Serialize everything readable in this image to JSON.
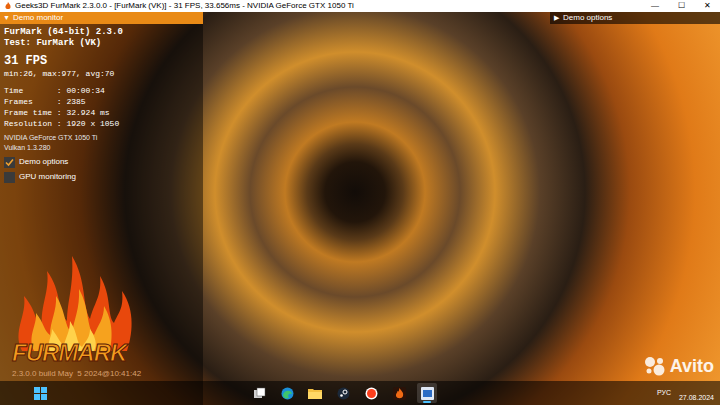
{
  "window": {
    "title": "Geeks3D FurMark 2.3.0.0 - [FurMark (VK)] - 31 FPS, 33.656ms - NVIDIA GeForce GTX 1050 Ti",
    "controls": [
      "—",
      "☐",
      "✕"
    ]
  },
  "demo_monitor": {
    "arrow": "▼",
    "header": "Demo monitor",
    "expanded": true,
    "app": "FurMark (64-bit) 2.3.0",
    "test": "Test: FurMark (VK)",
    "fps": "31 FPS",
    "stats": "min:26, max:977, avg:70",
    "info": [
      "Time       : 00:00:34",
      "Frames     : 2385",
      "Frame time : 32.924 ms",
      "Resolution : 1920 x 1050"
    ],
    "gpu": "NVIDIA GeForce GTX 1050 Ti",
    "api": "Vulkan 1.3.280",
    "options": [
      {
        "label": "Demo options",
        "checked": true
      },
      {
        "label": "GPU monitoring",
        "checked": false
      }
    ]
  },
  "demo_options": {
    "arrow": "▶",
    "header": "Demo options",
    "expanded": false
  },
  "logo": {
    "text": "FURMARK",
    "build": "2.3.0.0 build May  5 2024@10:41:42"
  },
  "taskbar": {
    "start": {
      "kind": "start"
    },
    "apps": [
      {
        "kind": "taskview",
        "selected": false
      },
      {
        "kind": "edge",
        "selected": false
      },
      {
        "kind": "explorer",
        "selected": false
      },
      {
        "kind": "steam",
        "selected": false
      },
      {
        "kind": "yandex",
        "selected": false
      },
      {
        "kind": "furmark",
        "selected": false
      },
      {
        "kind": "app",
        "selected": true
      }
    ],
    "language": "РУС",
    "date": "27.08.2024"
  },
  "watermark": "Avito"
}
